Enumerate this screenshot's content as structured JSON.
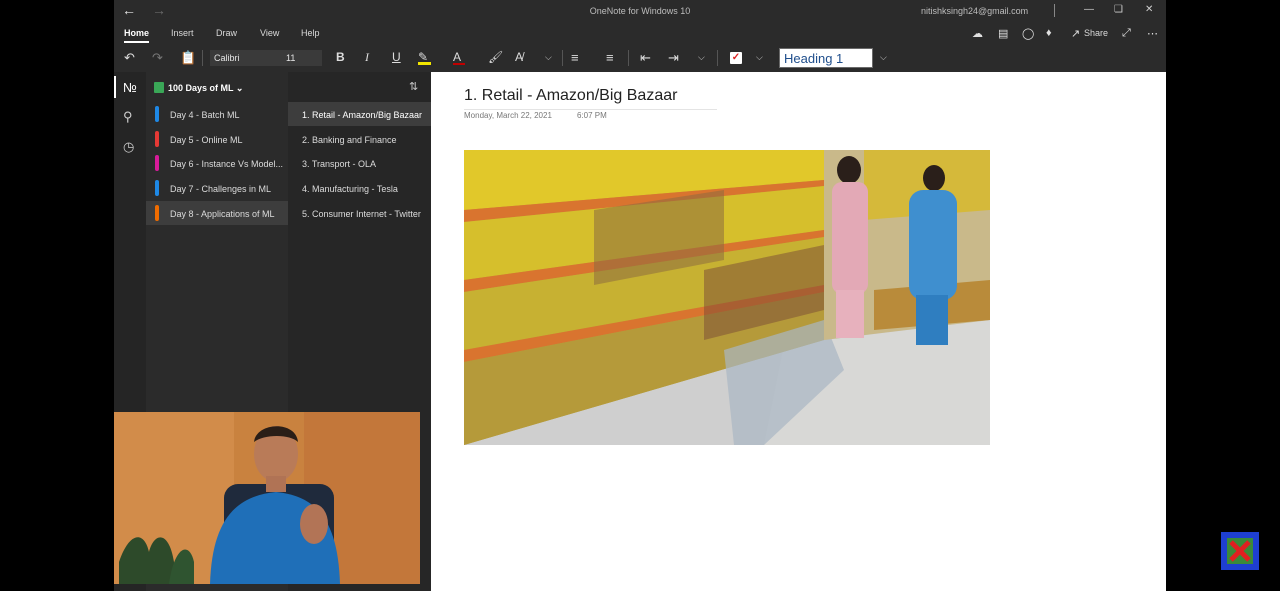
{
  "titlebar": {
    "app_title": "OneNote for Windows 10",
    "account": "nitishksingh24@gmail.com"
  },
  "menu": {
    "tabs": [
      "Home",
      "Insert",
      "Draw",
      "View",
      "Help"
    ],
    "share_label": "Share"
  },
  "toolbar": {
    "font_name": "Calibri",
    "font_size": "11",
    "style": "Heading 1",
    "highlight_color": "#f2e600",
    "font_color_bar": "#c00000"
  },
  "notebook": {
    "name": "100 Days of ML"
  },
  "sections": [
    {
      "label": "Day 4 - Batch ML",
      "color": "#1e88e5"
    },
    {
      "label": "Day 5 - Online ML",
      "color": "#e53935"
    },
    {
      "label": "Day 6 - Instance Vs Model...",
      "color": "#d81b9a"
    },
    {
      "label": "Day 7 - Challenges in ML",
      "color": "#1e88e5"
    },
    {
      "label": "Day 8 - Applications of ML",
      "color": "#ef6c00"
    }
  ],
  "pages": [
    {
      "label": "1. Retail - Amazon/Big Bazaar"
    },
    {
      "label": "2. Banking and Finance"
    },
    {
      "label": "3. Transport - OLA"
    },
    {
      "label": "4. Manufacturing - Tesla"
    },
    {
      "label": "5. Consumer Internet - Twitter"
    }
  ],
  "page": {
    "title": "1. Retail - Amazon/Big Bazaar",
    "date": "Monday, March 22, 2021",
    "time": "6:07 PM"
  },
  "icons": {
    "back": "back-arrow-icon",
    "forward": "forward-arrow-icon",
    "notebooks": "notebooks-icon",
    "search": "search-icon",
    "recent": "clock-icon"
  }
}
